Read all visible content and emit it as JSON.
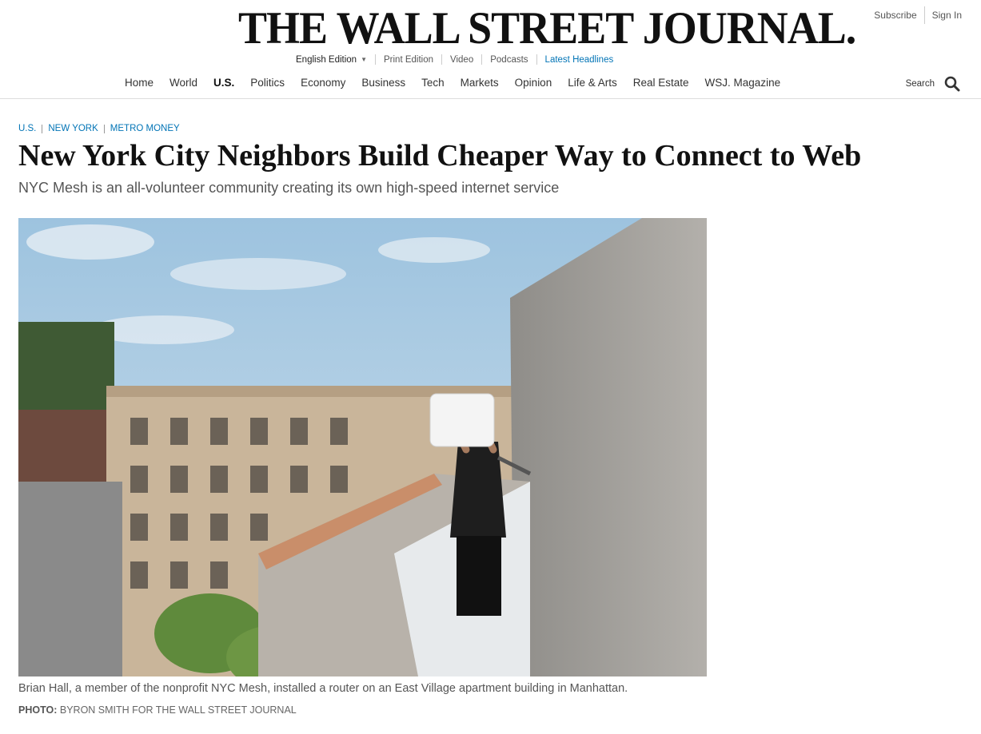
{
  "header": {
    "masthead": "THE WALL STREET JOURNAL.",
    "subscribe": "Subscribe",
    "sign_in": "Sign In",
    "edition": "English Edition",
    "subnav": [
      "Print Edition",
      "Video",
      "Podcasts",
      "Latest Headlines"
    ],
    "search_label": "Search",
    "search_icon": "search-icon"
  },
  "nav": {
    "items": [
      "Home",
      "World",
      "U.S.",
      "Politics",
      "Economy",
      "Business",
      "Tech",
      "Markets",
      "Opinion",
      "Life & Arts",
      "Real Estate",
      "WSJ. Magazine"
    ],
    "active": "U.S."
  },
  "article": {
    "breadcrumbs": [
      "U.S.",
      "NEW YORK",
      "METRO MONEY"
    ],
    "headline": "New York City Neighbors Build Cheaper Way to Connect to Web",
    "dek": "NYC Mesh is an all-volunteer community creating its own high-speed internet service",
    "caption": "Brian Hall, a member of the nonprofit NYC Mesh, installed a router on an East Village apartment building in Manhattan.",
    "credit_label": "PHOTO:",
    "credit": "BYRON SMITH FOR THE WALL STREET JOURNAL"
  },
  "colors": {
    "link_blue": "#0274b6",
    "text_dark": "#111111",
    "text_muted": "#555555"
  }
}
